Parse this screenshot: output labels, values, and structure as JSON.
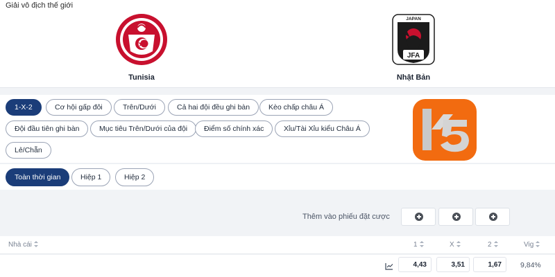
{
  "match": {
    "competition": "Giải vô địch thế giới",
    "home": {
      "name": "Tunisia"
    },
    "away": {
      "name": "Nhật Bản",
      "crest_text": "JAPAN",
      "crest_abbr": "JFA"
    }
  },
  "markets": [
    {
      "label": "1-X-2",
      "active": true
    },
    {
      "label": "Cơ hội gấp đôi"
    },
    {
      "label": "Trên/Dưới"
    },
    {
      "label": "Cả hai đội đều ghi bàn"
    },
    {
      "label": "Kèo chấp châu Á"
    },
    {
      "label": "Đội đầu tiên ghi bàn"
    },
    {
      "label": "Mục tiêu Trên/Dưới của đội"
    },
    {
      "label": "Điểm số chính xác"
    },
    {
      "label": "Xỉu/Tài Xỉu kiểu Châu Á"
    },
    {
      "label": "Lẻ/Chẵn"
    }
  ],
  "periods": [
    {
      "label": "Toàn thời gian",
      "active": true
    },
    {
      "label": "Hiệp 1"
    },
    {
      "label": "Hiệp 2"
    }
  ],
  "add_to_slip": {
    "label": "Thêm vào phiếu đặt cược",
    "icon": "plus-circle-icon"
  },
  "table": {
    "headers": {
      "bookmaker": "Nhà cái",
      "home": "1",
      "draw": "X",
      "away": "2",
      "vig": "Vig"
    },
    "rows": [
      {
        "icon": "chart-icon",
        "home": "4,43",
        "draw": "3,51",
        "away": "1,67",
        "vig": "9,84%"
      }
    ]
  },
  "brand": {
    "logo": "K5",
    "accent": "#f26b10",
    "active": "#1b3d79"
  }
}
